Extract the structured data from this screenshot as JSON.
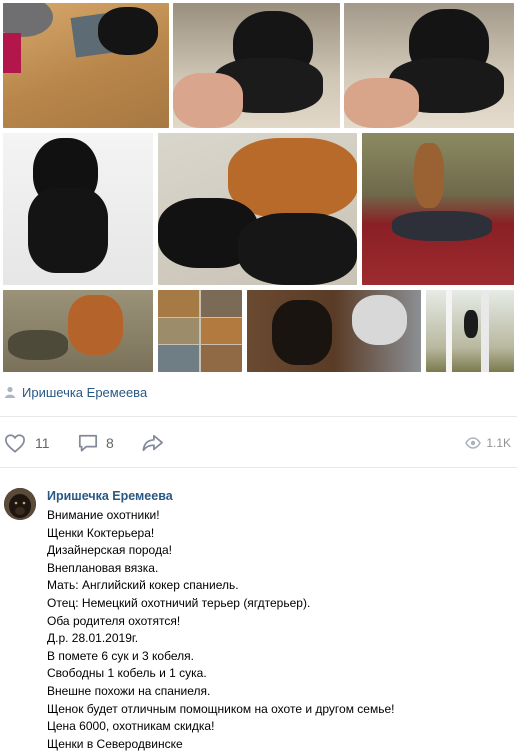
{
  "post": {
    "photo_author": "Иришечка Еремеева",
    "likes": "11",
    "comments": "8",
    "views": "1.1K"
  },
  "photos": [
    {
      "name": "photo-puppy-on-mat"
    },
    {
      "name": "photo-puppy-held-1"
    },
    {
      "name": "photo-puppy-held-2"
    },
    {
      "name": "photo-puppy-sitting"
    },
    {
      "name": "photo-mother-with-puppies"
    },
    {
      "name": "photo-spaniel-on-car"
    },
    {
      "name": "photo-spaniel-with-ducks"
    },
    {
      "name": "photo-collage"
    },
    {
      "name": "photo-terrier-with-bird"
    },
    {
      "name": "photo-birch-forest"
    }
  ],
  "comment": {
    "author": "Иришечка Еремеева",
    "lines": [
      "Внимание охотники!",
      "Щенки Коктерьера!",
      "Дизайнерская порода!",
      "Внеплановая вязка.",
      "Мать: Английский кокер спаниель.",
      "Отец: Немецкий охотничий терьер (ягдтерьер).",
      "Оба родителя охотятся!",
      "Д.р. 28.01.2019г.",
      "В помете 6 сук и 3 кобеля.",
      "Свободны 1 кобель и 1 сука.",
      "Внешне похожи на спаниеля.",
      "Щенок будет отличным помощником на охоте и другом семье!",
      "Цена 6000, охотникам скидка!",
      "Щенки в Северодвинске"
    ]
  },
  "colors": {
    "link": "#2a5885",
    "meta": "#656565",
    "divider": "#e7e8ec"
  }
}
